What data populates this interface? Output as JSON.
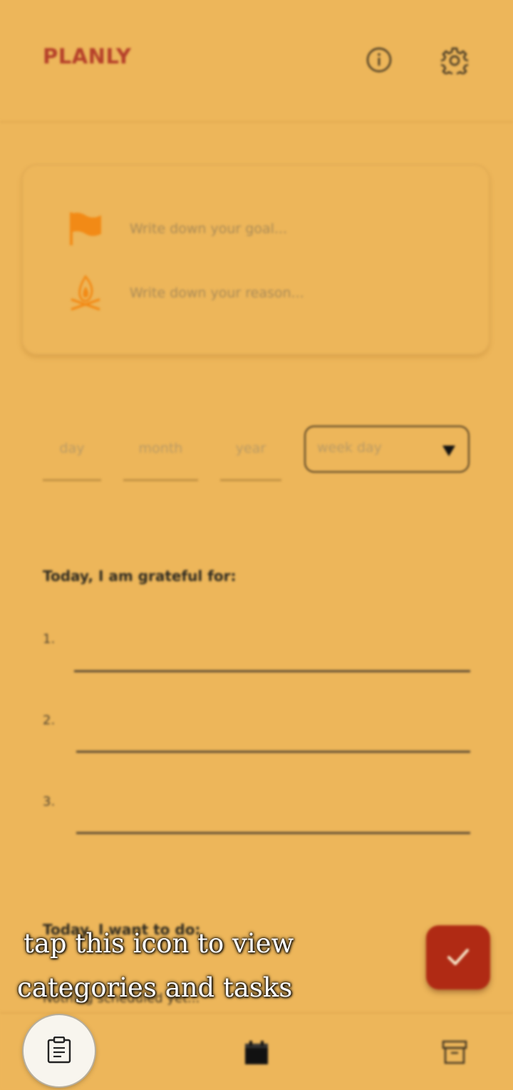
{
  "app": {
    "title": "PLANLY"
  },
  "header": {
    "icons": [
      "info-icon",
      "gear-icon"
    ]
  },
  "goal_card": {
    "goal_placeholder": "Write down your goal...",
    "reason_placeholder": "Write down your reason..."
  },
  "date": {
    "day_placeholder": "day",
    "month_placeholder": "month",
    "year_placeholder": "year",
    "weekday_placeholder": "week day"
  },
  "gratitude": {
    "title": "Today, I am grateful for:",
    "items": [
      "1.",
      "2.",
      "3."
    ]
  },
  "todo": {
    "title": "Today, I want to do:",
    "faded_text": "Nothing scheduled yet..."
  },
  "tooltip": {
    "line1": "tap this icon to view",
    "line2": "categories and tasks"
  },
  "colors": {
    "background": "#EDB65A",
    "brand": "#B5402A",
    "accent": "#B02A14",
    "icon_orange": "#F28A16"
  }
}
